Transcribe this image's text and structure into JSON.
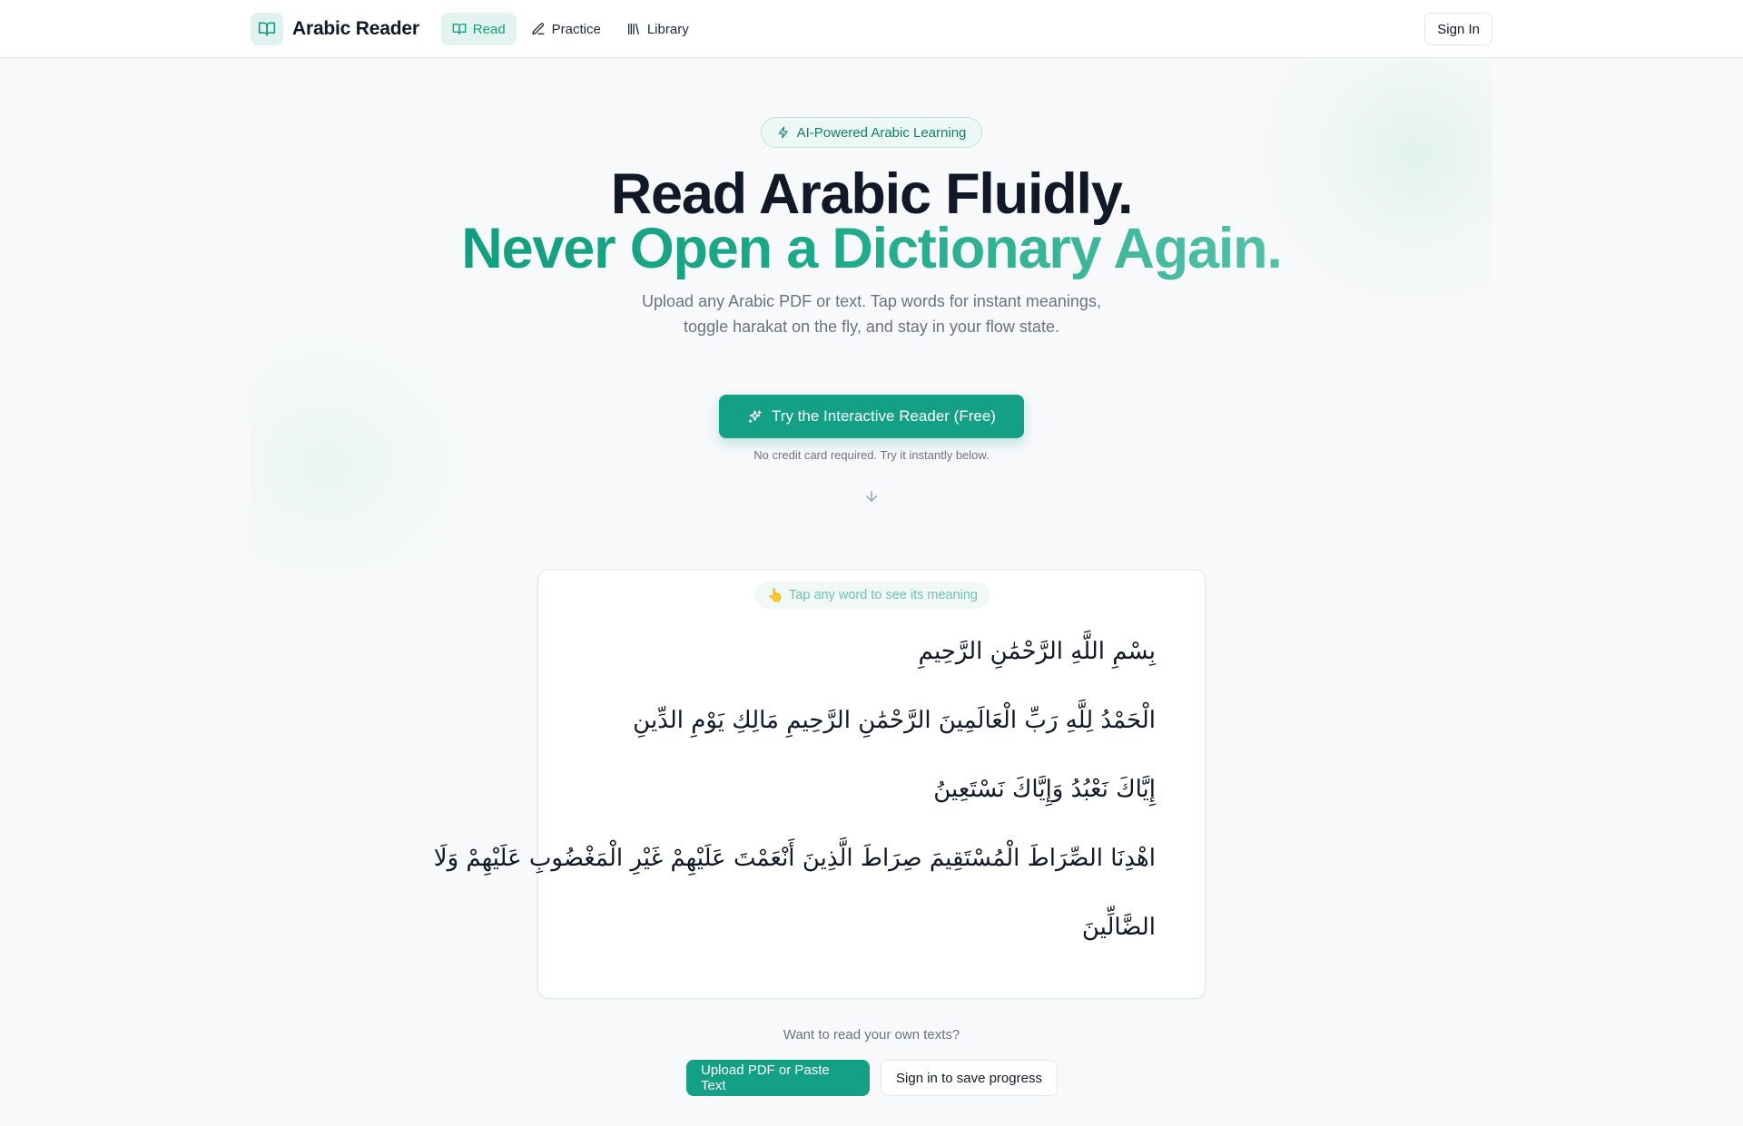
{
  "header": {
    "brand": "Arabic Reader",
    "nav": [
      {
        "label": "Read",
        "icon": "book-open-icon",
        "active": true
      },
      {
        "label": "Practice",
        "icon": "pencil-icon",
        "active": false
      },
      {
        "label": "Library",
        "icon": "library-icon",
        "active": false
      }
    ],
    "sign_in": "Sign In"
  },
  "hero": {
    "badge": "AI-Powered Arabic Learning",
    "title_line1": "Read Arabic Fluidly.",
    "title_line2": "Never Open a Dictionary Again.",
    "subtitle": "Upload any Arabic PDF or text. Tap words for instant meanings, toggle harakat on the fly, and stay in your flow state.",
    "cta": "Try the Interactive Reader (Free)",
    "note": "No credit card required. Try it instantly below."
  },
  "reader": {
    "hint_emoji": "👆",
    "hint": "Tap any word to see its meaning",
    "lines": [
      [
        "بِسْمِ",
        "اللَّهِ",
        "الرَّحْمَٰنِ",
        "الرَّحِيمِ"
      ],
      [
        "الْحَمْدُ",
        "لِلَّهِ",
        "رَبِّ",
        "الْعَالَمِينَ",
        "الرَّحْمَٰنِ",
        "الرَّحِيمِ",
        "مَالِكِ",
        "يَوْمِ",
        "الدِّينِ"
      ],
      [
        "إِيَّاكَ",
        "نَعْبُدُ",
        "وَإِيَّاكَ",
        "نَسْتَعِينُ"
      ],
      [
        "اهْدِنَا",
        "الصِّرَاطَ",
        "الْمُسْتَقِيمَ",
        "صِرَاطَ",
        "الَّذِينَ",
        "أَنْعَمْتَ",
        "عَلَيْهِمْ",
        "غَيْرِ",
        "الْمَغْضُوبِ",
        "عَلَيْهِمْ",
        "وَلَا"
      ],
      [
        "الضَّالِّينَ"
      ]
    ]
  },
  "footer_cta": {
    "prompt": "Want to read your own texts?",
    "upload": "Upload PDF or Paste Text",
    "save": "Sign in to save progress"
  },
  "colors": {
    "accent": "#13a085",
    "accent_light": "#e3f3ef",
    "text": "#111827",
    "muted": "#6b7280"
  }
}
